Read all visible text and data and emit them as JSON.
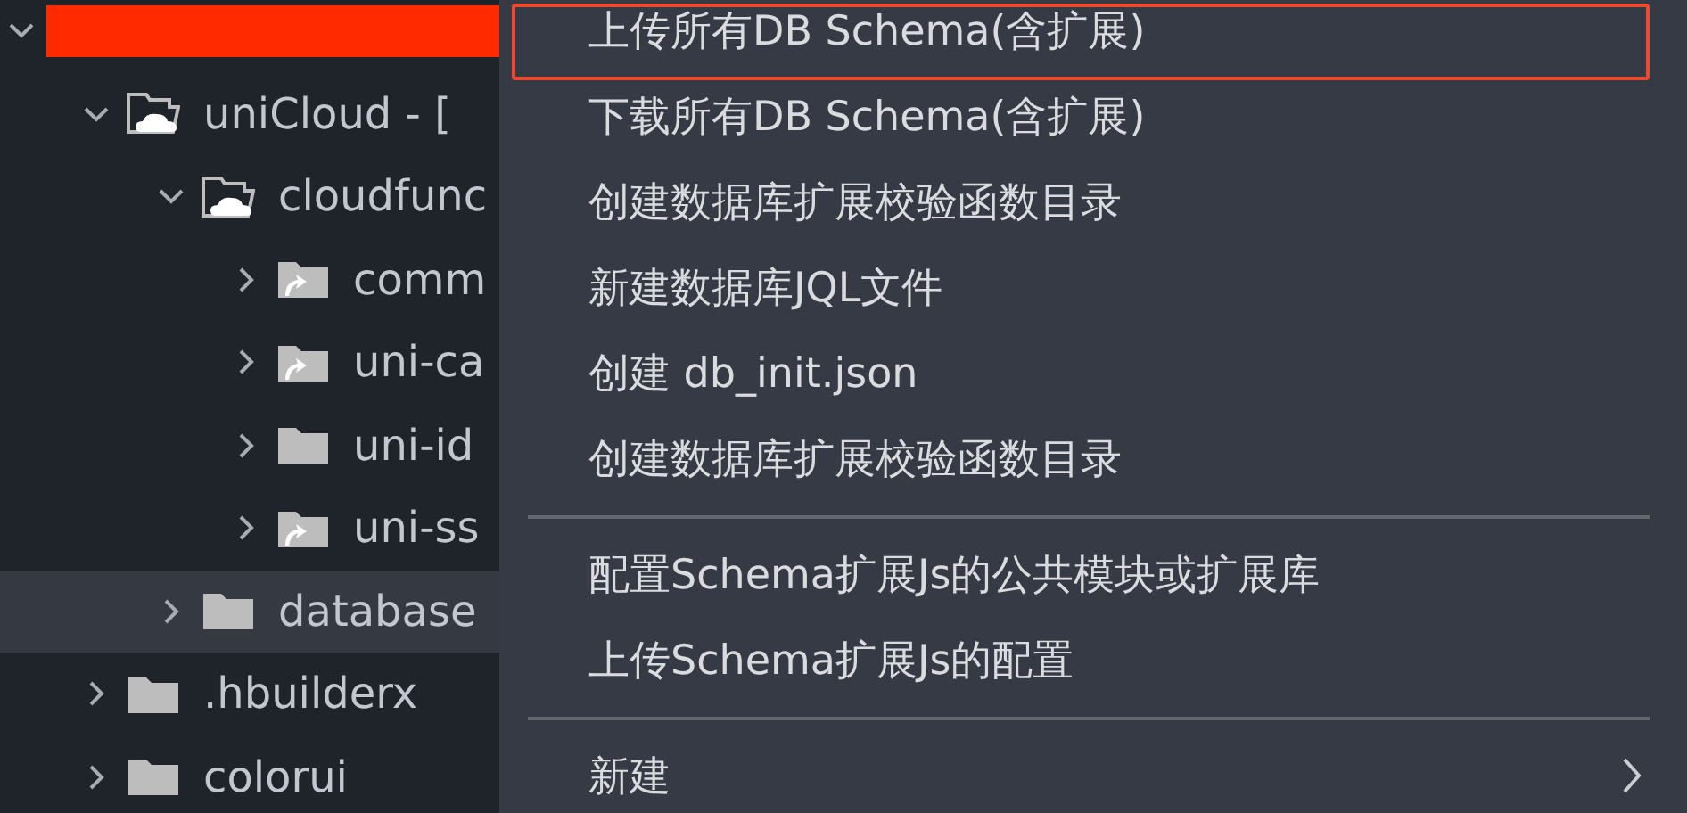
{
  "tree": [
    {
      "redacted": true,
      "expanded": true,
      "selected": false,
      "children": [
        {
          "label": "uniCloud - [",
          "expanded": true,
          "kind": "cloud-folder",
          "selected": false,
          "children": [
            {
              "label": "cloudfunc",
              "expanded": true,
              "kind": "cloud-folder",
              "selected": false,
              "children": [
                {
                  "label": "comm",
                  "expanded": false,
                  "kind": "link-folder",
                  "selected": false
                },
                {
                  "label": "uni-ca",
                  "expanded": false,
                  "kind": "link-folder",
                  "selected": false
                },
                {
                  "label": "uni-id",
                  "expanded": false,
                  "kind": "folder",
                  "selected": false
                },
                {
                  "label": "uni-ss",
                  "expanded": false,
                  "kind": "link-folder",
                  "selected": false
                }
              ]
            },
            {
              "label": "database",
              "expanded": false,
              "kind": "folder",
              "selected": true
            }
          ]
        },
        {
          "label": ".hbuilderx",
          "expanded": false,
          "kind": "folder",
          "selected": false
        },
        {
          "label": "colorui",
          "expanded": false,
          "kind": "folder",
          "selected": false
        }
      ]
    }
  ],
  "context_menu": [
    {
      "kind": "item",
      "label": "上传所有DB Schema(含扩展)",
      "highlighted": true
    },
    {
      "kind": "item",
      "label": "下载所有DB Schema(含扩展)",
      "highlighted": false
    },
    {
      "kind": "item",
      "label": "创建数据库扩展校验函数目录",
      "highlighted": false
    },
    {
      "kind": "item",
      "label": "新建数据库JQL文件",
      "highlighted": false
    },
    {
      "kind": "item",
      "label": "创建 db_init.json",
      "highlighted": false
    },
    {
      "kind": "item",
      "label": "创建数据库扩展校验函数目录",
      "highlighted": false
    },
    {
      "kind": "separator"
    },
    {
      "kind": "item",
      "label": "配置Schema扩展Js的公共模块或扩展库",
      "highlighted": false
    },
    {
      "kind": "item",
      "label": "上传Schema扩展Js的配置",
      "highlighted": false
    },
    {
      "kind": "separator"
    },
    {
      "kind": "submenu",
      "label": "新建",
      "highlighted": false
    }
  ]
}
